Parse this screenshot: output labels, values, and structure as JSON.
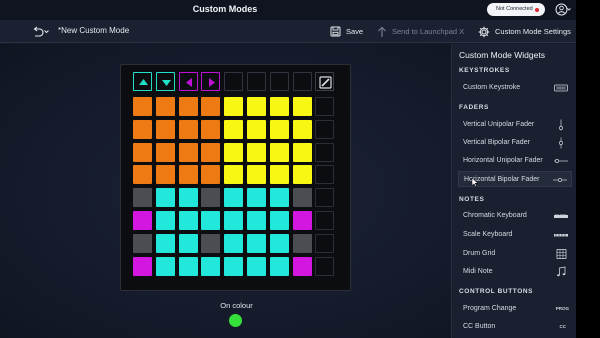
{
  "app": {
    "window_title": "Custom Modes",
    "connection_status": "Not Connected",
    "user_icon": "user-icon"
  },
  "toolbar": {
    "document_name": "*New Custom Mode",
    "save_label": "Save",
    "send_label": "Send to Launchpad X",
    "settings_label": "Custom Mode Settings"
  },
  "launchpad": {
    "colors": {
      "orange": "#ee7a14",
      "yellow": "#f7f713",
      "cyan": "#22e8dc",
      "magenta": "#d316e0",
      "grey": "#4a4d52",
      "dark": "#0b0d10",
      "arrow_green": "#20e0c8",
      "arrow_purple": "#c010d8"
    },
    "top_buttons": [
      "up-arrow",
      "down-arrow",
      "left-arrow",
      "right-arrow",
      "blank",
      "blank",
      "blank",
      "blank"
    ],
    "logo_icon": "novation-logo-icon",
    "grid": [
      [
        "orange",
        "orange",
        "orange",
        "orange",
        "yellow",
        "yellow",
        "yellow",
        "yellow"
      ],
      [
        "orange",
        "orange",
        "orange",
        "orange",
        "yellow",
        "yellow",
        "yellow",
        "yellow"
      ],
      [
        "orange",
        "orange",
        "orange",
        "orange",
        "yellow",
        "yellow",
        "yellow",
        "yellow"
      ],
      [
        "orange",
        "orange",
        "orange",
        "orange",
        "yellow",
        "yellow",
        "yellow",
        "yellow"
      ],
      [
        "grey",
        "cyan",
        "cyan",
        "grey",
        "cyan",
        "cyan",
        "cyan",
        "grey"
      ],
      [
        "magenta",
        "cyan",
        "cyan",
        "cyan",
        "cyan",
        "cyan",
        "cyan",
        "magenta"
      ],
      [
        "grey",
        "cyan",
        "cyan",
        "grey",
        "cyan",
        "cyan",
        "cyan",
        "grey"
      ],
      [
        "magenta",
        "cyan",
        "cyan",
        "cyan",
        "cyan",
        "cyan",
        "cyan",
        "magenta"
      ]
    ]
  },
  "on_colour": {
    "label": "On colour",
    "color": "#35e03a"
  },
  "panel": {
    "title": "Custom Mode Widgets",
    "sections": {
      "keystrokes": "KEYSTROKES",
      "faders": "FADERS",
      "notes": "NOTES",
      "control_buttons": "CONTROL BUTTONS"
    },
    "items": {
      "custom_keystroke": "Custom Keystroke",
      "vertical_unipolar": "Vertical Unipolar Fader",
      "vertical_bipolar": "Vertical Bipolar Fader",
      "horizontal_unipolar": "Horizontal Unipolar Fader",
      "horizontal_bipolar": "Horizontal Bipolar Fader",
      "chromatic_keyboard": "Chromatic Keyboard",
      "scale_keyboard": "Scale Keyboard",
      "drum_grid": "Drum Grid",
      "midi_note": "Midi Note",
      "program_change": "Program Change",
      "cc_button": "CC Button"
    },
    "icon_text": {
      "program_change": "PROG",
      "cc_button": "CC"
    }
  }
}
